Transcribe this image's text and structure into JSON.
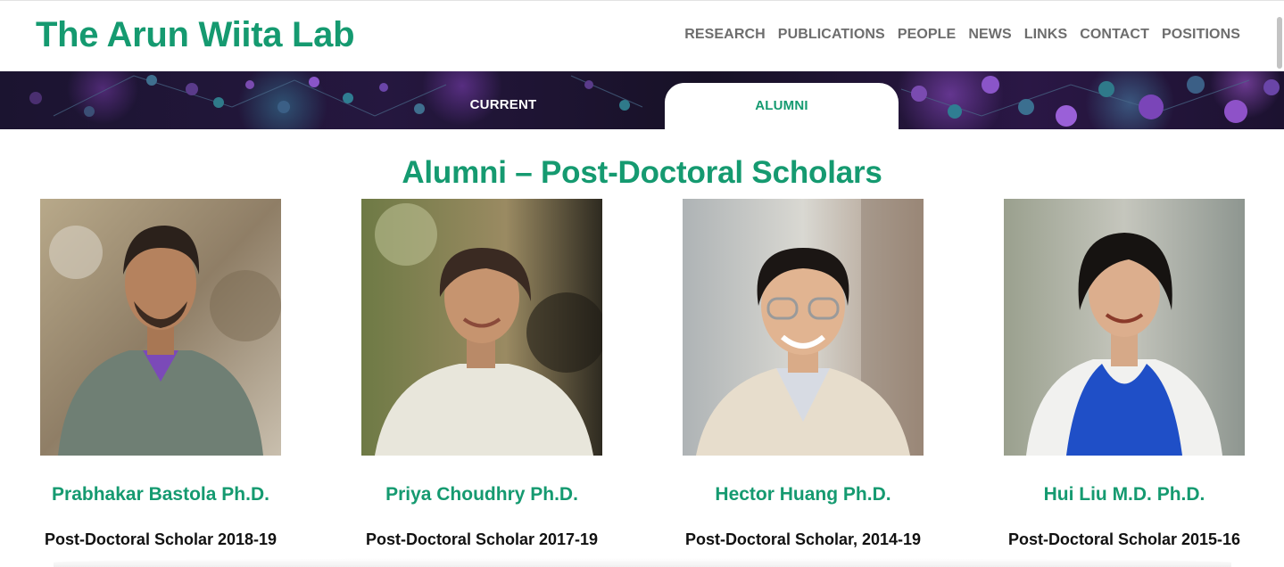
{
  "header": {
    "logo": "The Arun Wiita Lab",
    "nav": [
      "RESEARCH",
      "PUBLICATIONS",
      "PEOPLE",
      "NEWS",
      "LINKS",
      "CONTACT",
      "POSITIONS"
    ]
  },
  "tabs": {
    "current": "CURRENT",
    "alumni": "ALUMNI",
    "active": "ALUMNI"
  },
  "section": {
    "title": "Alumni – Post-Doctoral Scholars"
  },
  "people": [
    {
      "name": "Prabhakar Bastola Ph.D.",
      "role": "Post-Doctoral Scholar 2018-19"
    },
    {
      "name": "Priya Choudhry Ph.D.",
      "role": "Post-Doctoral Scholar 2017-19"
    },
    {
      "name": "Hector Huang Ph.D.",
      "role": "Post-Doctoral Scholar, 2014-19"
    },
    {
      "name": "Hui Liu M.D. Ph.D.",
      "role": "Post-Doctoral Scholar 2015-16"
    }
  ],
  "colors": {
    "brand": "#159a70",
    "nav": "#6d6d6d",
    "banner": "#1b1430"
  }
}
